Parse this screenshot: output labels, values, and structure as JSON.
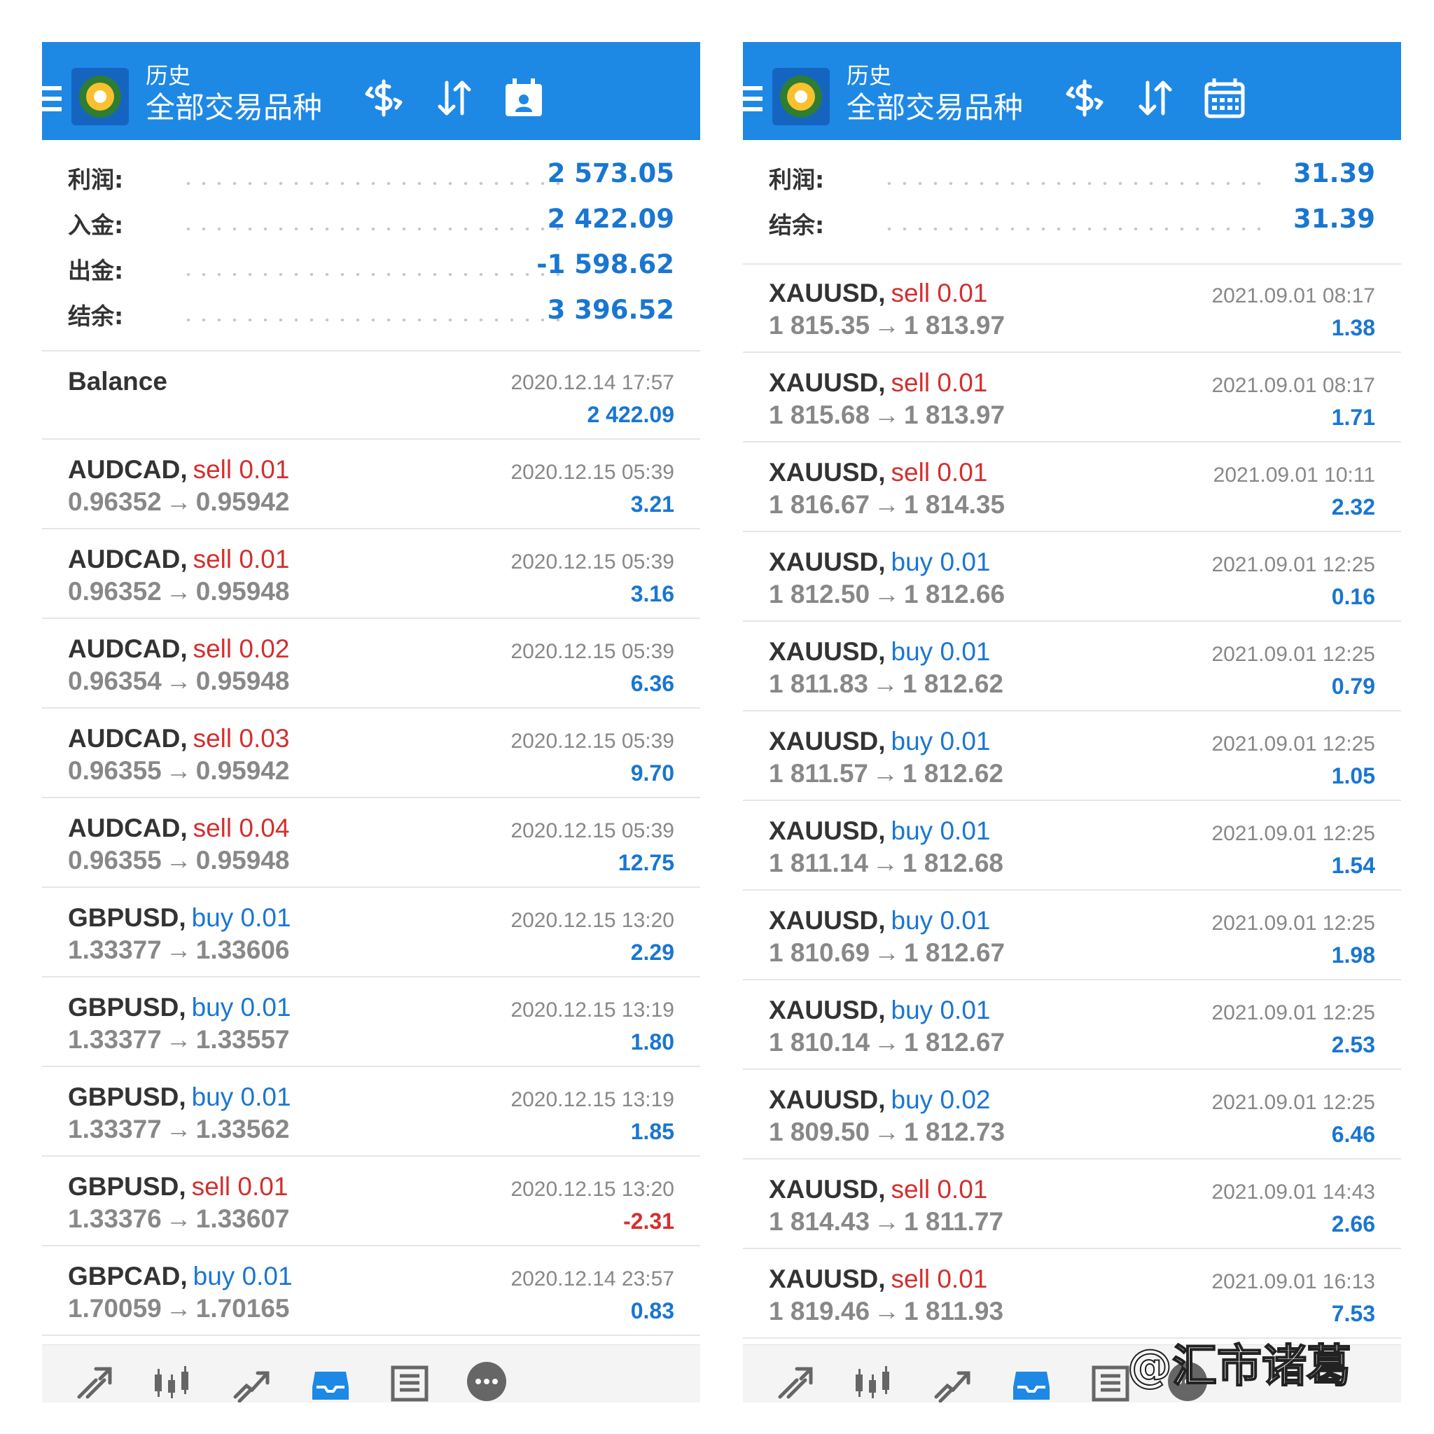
{
  "left": {
    "header": {
      "title": "历史",
      "subtitle": "全部交易品种"
    },
    "summary": [
      {
        "label": "利润:",
        "value": "2 573.05"
      },
      {
        "label": "入金:",
        "value": "2 422.09"
      },
      {
        "label": "出金:",
        "value": "-1 598.62"
      },
      {
        "label": "结余:",
        "value": "3 396.52"
      }
    ],
    "balance": {
      "label": "Balance",
      "time": "2020.12.14 17:57",
      "amount": "2 422.09"
    },
    "deals": [
      {
        "symbol": "AUDCAD",
        "side": "sell",
        "lot": "0.01",
        "open": "0.96352",
        "close": "0.95942",
        "time": "2020.12.15 05:39",
        "profit": "3.21"
      },
      {
        "symbol": "AUDCAD",
        "side": "sell",
        "lot": "0.01",
        "open": "0.96352",
        "close": "0.95948",
        "time": "2020.12.15 05:39",
        "profit": "3.16"
      },
      {
        "symbol": "AUDCAD",
        "side": "sell",
        "lot": "0.02",
        "open": "0.96354",
        "close": "0.95948",
        "time": "2020.12.15 05:39",
        "profit": "6.36"
      },
      {
        "symbol": "AUDCAD",
        "side": "sell",
        "lot": "0.03",
        "open": "0.96355",
        "close": "0.95942",
        "time": "2020.12.15 05:39",
        "profit": "9.70"
      },
      {
        "symbol": "AUDCAD",
        "side": "sell",
        "lot": "0.04",
        "open": "0.96355",
        "close": "0.95948",
        "time": "2020.12.15 05:39",
        "profit": "12.75"
      },
      {
        "symbol": "GBPUSD",
        "side": "buy",
        "lot": "0.01",
        "open": "1.33377",
        "close": "1.33606",
        "time": "2020.12.15 13:20",
        "profit": "2.29"
      },
      {
        "symbol": "GBPUSD",
        "side": "buy",
        "lot": "0.01",
        "open": "1.33377",
        "close": "1.33557",
        "time": "2020.12.15 13:19",
        "profit": "1.80"
      },
      {
        "symbol": "GBPUSD",
        "side": "buy",
        "lot": "0.01",
        "open": "1.33377",
        "close": "1.33562",
        "time": "2020.12.15 13:19",
        "profit": "1.85"
      },
      {
        "symbol": "GBPUSD",
        "side": "sell",
        "lot": "0.01",
        "open": "1.33376",
        "close": "1.33607",
        "time": "2020.12.15 13:20",
        "profit": "-2.31"
      },
      {
        "symbol": "GBPCAD",
        "side": "buy",
        "lot": "0.01",
        "open": "1.70059",
        "close": "1.70165",
        "time": "2020.12.14 23:57",
        "profit": "0.83"
      }
    ]
  },
  "right": {
    "header": {
      "title": "历史",
      "subtitle": "全部交易品种"
    },
    "summary": [
      {
        "label": "利润:",
        "value": "31.39"
      },
      {
        "label": "结余:",
        "value": "31.39"
      }
    ],
    "deals": [
      {
        "symbol": "XAUUSD",
        "side": "sell",
        "lot": "0.01",
        "open": "1 815.35",
        "close": "1 813.97",
        "time": "2021.09.01 08:17",
        "profit": "1.38"
      },
      {
        "symbol": "XAUUSD",
        "side": "sell",
        "lot": "0.01",
        "open": "1 815.68",
        "close": "1 813.97",
        "time": "2021.09.01 08:17",
        "profit": "1.71"
      },
      {
        "symbol": "XAUUSD",
        "side": "sell",
        "lot": "0.01",
        "open": "1 816.67",
        "close": "1 814.35",
        "time": "2021.09.01 10:11",
        "profit": "2.32"
      },
      {
        "symbol": "XAUUSD",
        "side": "buy",
        "lot": "0.01",
        "open": "1 812.50",
        "close": "1 812.66",
        "time": "2021.09.01 12:25",
        "profit": "0.16"
      },
      {
        "symbol": "XAUUSD",
        "side": "buy",
        "lot": "0.01",
        "open": "1 811.83",
        "close": "1 812.62",
        "time": "2021.09.01 12:25",
        "profit": "0.79"
      },
      {
        "symbol": "XAUUSD",
        "side": "buy",
        "lot": "0.01",
        "open": "1 811.57",
        "close": "1 812.62",
        "time": "2021.09.01 12:25",
        "profit": "1.05"
      },
      {
        "symbol": "XAUUSD",
        "side": "buy",
        "lot": "0.01",
        "open": "1 811.14",
        "close": "1 812.68",
        "time": "2021.09.01 12:25",
        "profit": "1.54"
      },
      {
        "symbol": "XAUUSD",
        "side": "buy",
        "lot": "0.01",
        "open": "1 810.69",
        "close": "1 812.67",
        "time": "2021.09.01 12:25",
        "profit": "1.98"
      },
      {
        "symbol": "XAUUSD",
        "side": "buy",
        "lot": "0.01",
        "open": "1 810.14",
        "close": "1 812.67",
        "time": "2021.09.01 12:25",
        "profit": "2.53"
      },
      {
        "symbol": "XAUUSD",
        "side": "buy",
        "lot": "0.02",
        "open": "1 809.50",
        "close": "1 812.73",
        "time": "2021.09.01 12:25",
        "profit": "6.46"
      },
      {
        "symbol": "XAUUSD",
        "side": "sell",
        "lot": "0.01",
        "open": "1 814.43",
        "close": "1 811.77",
        "time": "2021.09.01 14:43",
        "profit": "2.66"
      },
      {
        "symbol": "XAUUSD",
        "side": "sell",
        "lot": "0.01",
        "open": "1 819.46",
        "close": "1 811.93",
        "time": "2021.09.01 16:13",
        "profit": "7.53"
      }
    ]
  },
  "arrow_glyph": "→",
  "watermark": "@汇市诸葛",
  "colors": {
    "accent": "#1e88e5",
    "profit_blue": "#1976d2",
    "sell_red": "#d32f2f",
    "muted": "#888888"
  },
  "icons": {
    "toolbar": [
      "menu-icon",
      "app-logo-icon",
      "dollar-filter-icon",
      "sort-icon",
      "calendar-icon"
    ],
    "bottom_nav": [
      "quotes-icon",
      "chart-icon",
      "trade-icon",
      "history-icon",
      "news-icon",
      "chat-icon"
    ]
  }
}
